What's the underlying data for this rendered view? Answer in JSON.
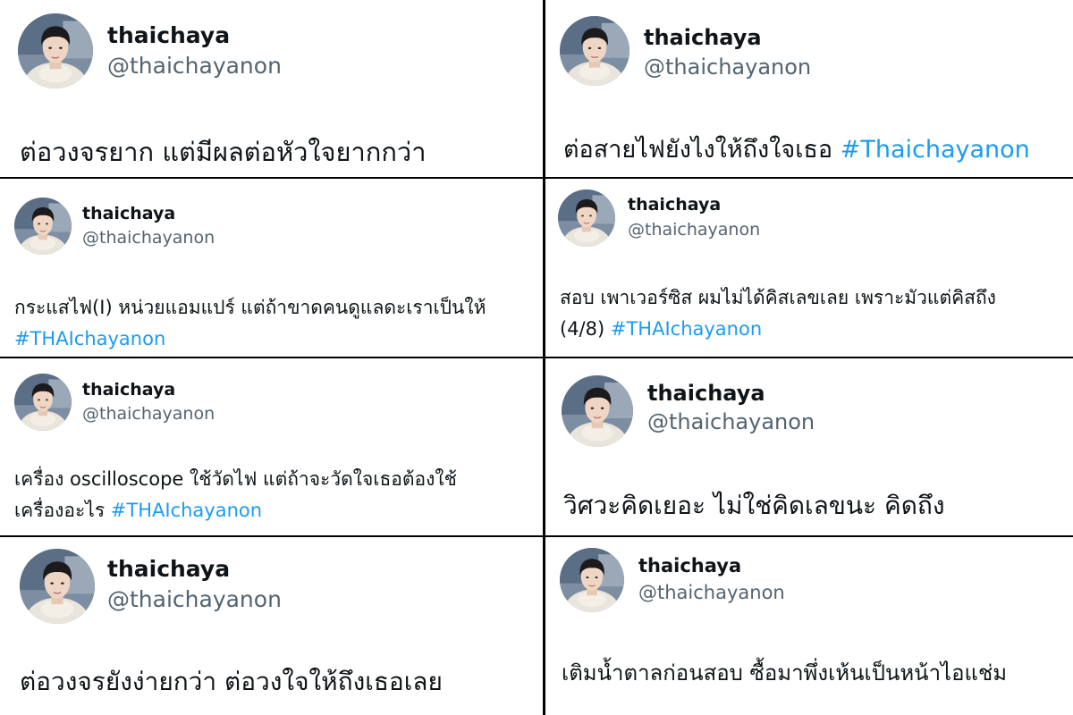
{
  "colors": {
    "text": "#0f1419",
    "handle": "#536471",
    "hashtag": "#1d9bf0",
    "divider": "#000000"
  },
  "avatar_icon": "profile-photo",
  "tweets": [
    {
      "name": "thaichaya",
      "handle": "@thaichayanon",
      "text": "ต่อวงจรยาก แต่มีผลต่อหัวใจยากกว่า",
      "hashtag": ""
    },
    {
      "name": "thaichaya",
      "handle": "@thaichayanon",
      "text": "ต่อสายไฟยังไงให้ถึงใจเธอ",
      "hashtag": "#Thaichayanon"
    },
    {
      "name": "thaichaya",
      "handle": "@thaichayanon",
      "text": "กระแสไฟ(I) หน่วยแอมแปร์ แต่ถ้าขาดคนดูแลดะเราเป็นให้",
      "hashtag": "#THAIchayanon"
    },
    {
      "name": "thaichaya",
      "handle": "@thaichayanon",
      "text": "สอบ เพาเวอร์ซิส ผมไม่ได้คิสเลขเลย เพราะมัวแต่คิสถึง",
      "text2": "(4/8)",
      "hashtag": "#THAIchayanon"
    },
    {
      "name": "thaichaya",
      "handle": "@thaichayanon",
      "text": "เครื่อง oscilloscope ใช้วัดไฟ แต่ถ้าจะวัดใจเธอต้องใช้",
      "text2": "เครื่องอะไร",
      "hashtag": "#THAIchayanon"
    },
    {
      "name": "thaichaya",
      "handle": "@thaichayanon",
      "text": "วิศวะคิดเยอะ ไม่ใช่คิดเลขนะ คิดถึง",
      "hashtag": ""
    },
    {
      "name": "thaichaya",
      "handle": "@thaichayanon",
      "text": "ต่อวงจรยังง่ายกว่า ต่อวงใจให้ถึงเธอเลย",
      "hashtag": ""
    },
    {
      "name": "thaichaya",
      "handle": "@thaichayanon",
      "text": "เติมน้ำตาลก่อนสอบ ซื้อมาพึ่งเห้นเป็นหน้าไอแช่ม",
      "hashtag": ""
    }
  ]
}
